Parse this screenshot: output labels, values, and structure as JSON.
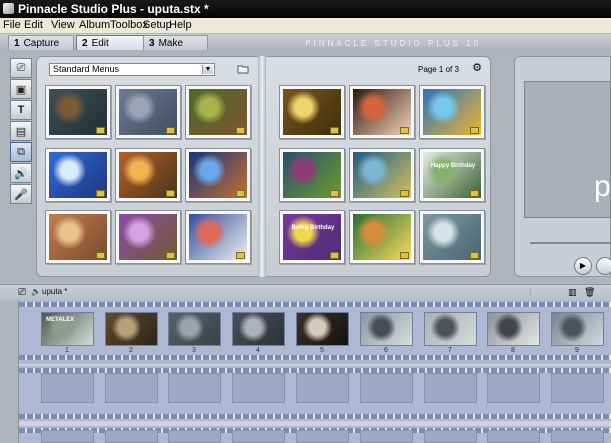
{
  "window": {
    "title": "Pinnacle Studio Plus - uputa.stx *"
  },
  "menu": [
    "File",
    "Edit",
    "View",
    "Album",
    "Toolbox",
    "Setup",
    "Help"
  ],
  "modes": [
    {
      "num": "1",
      "label": "Capture"
    },
    {
      "num": "2",
      "label": "Edit"
    },
    {
      "num": "3",
      "label": "Make Movie"
    }
  ],
  "brand": "PINNACLE STUDIO PLUS 10",
  "album": {
    "section": "Standard Menus",
    "page_label": "Page 1 of 3",
    "thumbnails": [
      {
        "caption": "",
        "colors": [
          "#3f4f59",
          "#7a5a37",
          "#1f2f33"
        ]
      },
      {
        "caption": "",
        "colors": [
          "#6d7b91",
          "#9aa4b6",
          "#404c60"
        ]
      },
      {
        "caption": "",
        "colors": [
          "#4d6b2a",
          "#a6b44b",
          "#7c5630"
        ]
      },
      {
        "caption": "",
        "colors": [
          "#78551f",
          "#f0d36b",
          "#3d2e0c"
        ]
      },
      {
        "caption": "",
        "colors": [
          "#2e1a10",
          "#d6643b",
          "#f4d2b8"
        ]
      },
      {
        "caption": "",
        "colors": [
          "#2575c2",
          "#78c7f0",
          "#f2b32b"
        ]
      },
      {
        "caption": "",
        "colors": [
          "#2f6ad9",
          "#d8ecff",
          "#1f3580"
        ]
      },
      {
        "caption": "",
        "colors": [
          "#b56127",
          "#f4b350",
          "#4a341d"
        ]
      },
      {
        "caption": "",
        "colors": [
          "#15347d",
          "#6aa7ea",
          "#ca6f2e"
        ]
      },
      {
        "caption": "",
        "colors": [
          "#29506d",
          "#8d3d74",
          "#6c9b2f"
        ]
      },
      {
        "caption": "",
        "colors": [
          "#1f5a86",
          "#78b8d5",
          "#d3c25f"
        ]
      },
      {
        "caption": "Happy Birthday",
        "colors": [
          "#e6ece5",
          "#87b06d",
          "#3b6431"
        ]
      },
      {
        "caption": "",
        "colors": [
          "#c27b4c",
          "#e7c48b",
          "#7a4c2d"
        ]
      },
      {
        "caption": "",
        "colors": [
          "#8b4ba9",
          "#d6a0e2",
          "#6f5b32"
        ]
      },
      {
        "caption": "",
        "colors": [
          "#304e9d",
          "#df6958",
          "#efefef"
        ]
      },
      {
        "caption": "Being Birthday",
        "colors": [
          "#7a379d",
          "#f0d54d",
          "#4a2d75"
        ]
      },
      {
        "caption": "",
        "colors": [
          "#2a6d35",
          "#d58d39",
          "#f6dc5f"
        ]
      },
      {
        "caption": "",
        "colors": [
          "#7f97a2",
          "#d7e3e8",
          "#486673"
        ]
      }
    ]
  },
  "preview": {
    "text": "p"
  },
  "movie": {
    "project_name": "uputa *",
    "frames": [
      {
        "label": "1",
        "colors": [
          "#4f5750",
          "#8e9b91",
          "#d4ddd7"
        ],
        "caption": "METALEX"
      },
      {
        "label": "2",
        "colors": [
          "#5e4a2d",
          "#b5a27b",
          "#2f261a"
        ],
        "caption": ""
      },
      {
        "label": "3",
        "colors": [
          "#556169",
          "#9aa5ab",
          "#3b4245"
        ],
        "caption": ""
      },
      {
        "label": "4",
        "colors": [
          "#49505a",
          "#aeb2b8",
          "#2e3238"
        ],
        "caption": ""
      },
      {
        "label": "5",
        "colors": [
          "#3d3127",
          "#d6ccbc",
          "#161211"
        ],
        "caption": ""
      },
      {
        "label": "6",
        "colors": [
          "#8997a5",
          "#4a4d57",
          "#d9ddd8"
        ],
        "caption": ""
      },
      {
        "label": "7",
        "colors": [
          "#a9b2b8",
          "#4f5355",
          "#d5d9d9"
        ],
        "caption": ""
      },
      {
        "label": "8",
        "colors": [
          "#8c9198",
          "#41454a",
          "#e5e5e5"
        ],
        "caption": ""
      },
      {
        "label": "9",
        "colors": [
          "#798491",
          "#4d535a",
          "#d3d8dc"
        ],
        "caption": ""
      }
    ]
  }
}
